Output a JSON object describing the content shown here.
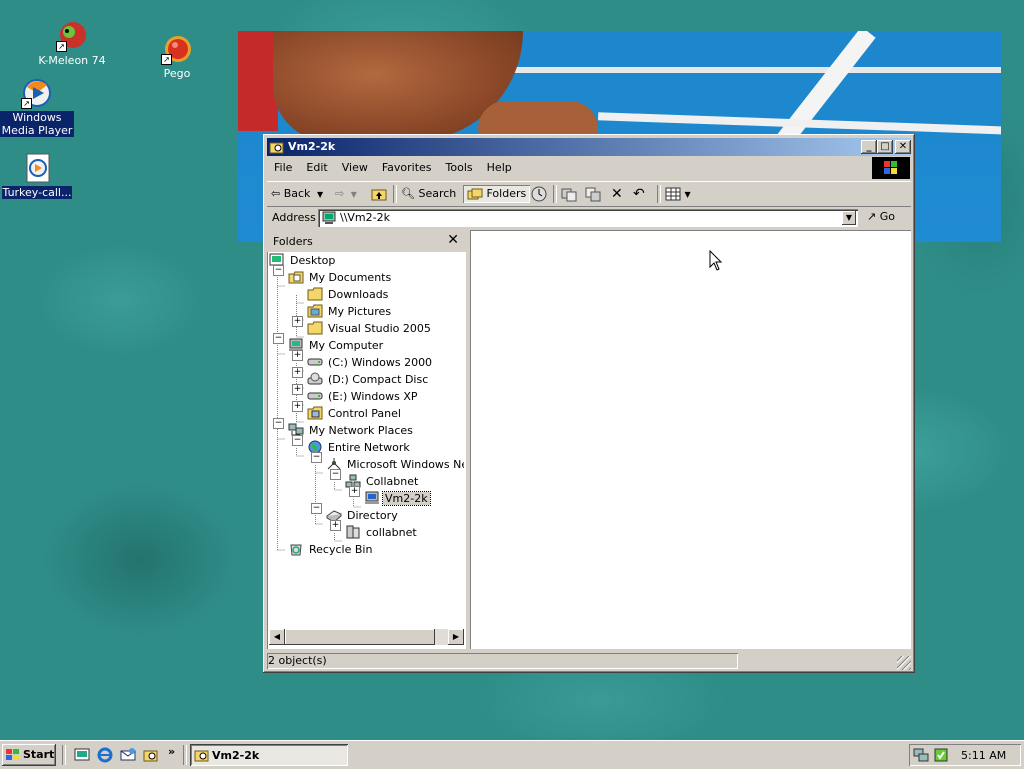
{
  "desktop": {
    "icons": [
      {
        "label": "K-Meleon 74"
      },
      {
        "label": "Pego"
      },
      {
        "label": "Windows Media Player"
      },
      {
        "label": "Turkey-call..."
      }
    ]
  },
  "window": {
    "title": "Vm2-2k",
    "menu": [
      "File",
      "Edit",
      "View",
      "Favorites",
      "Tools",
      "Help"
    ],
    "toolbar": {
      "back": "Back",
      "search": "Search",
      "folders": "Folders"
    },
    "address": {
      "label": "Address",
      "value": "\\\\Vm2-2k",
      "go": "Go"
    },
    "folders_pane": {
      "title": "Folders",
      "close": "✕",
      "tree": [
        {
          "label": "Desktop"
        },
        {
          "label": "My Documents"
        },
        {
          "label": "Downloads"
        },
        {
          "label": "My Pictures"
        },
        {
          "label": "Visual Studio 2005"
        },
        {
          "label": "My Computer"
        },
        {
          "label": "(C:) Windows 2000"
        },
        {
          "label": "(D:) Compact Disc"
        },
        {
          "label": "(E:) Windows XP"
        },
        {
          "label": "Control Panel"
        },
        {
          "label": "My Network Places"
        },
        {
          "label": "Entire Network"
        },
        {
          "label": "Microsoft Windows Network"
        },
        {
          "label": "Collabnet"
        },
        {
          "label": "Vm2-2k"
        },
        {
          "label": "Directory"
        },
        {
          "label": "collabnet"
        },
        {
          "label": "Recycle Bin"
        }
      ]
    },
    "status": "2 object(s)"
  },
  "taskbar": {
    "start": "Start",
    "task_label": "Vm2-2k",
    "chevron": "»",
    "clock": "5:11 AM"
  }
}
